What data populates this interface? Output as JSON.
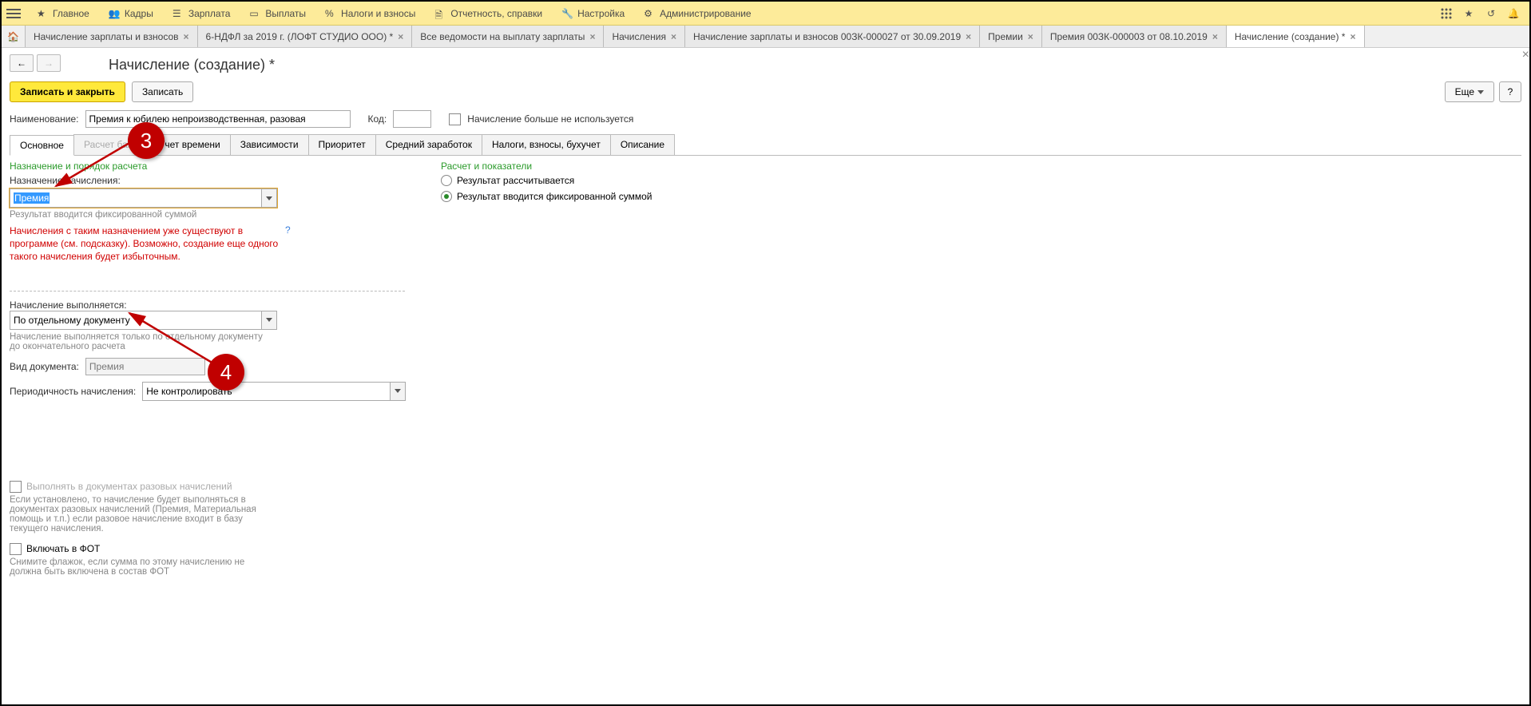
{
  "topnav": {
    "items": [
      {
        "icon": "star",
        "label": "Главное"
      },
      {
        "icon": "people",
        "label": "Кадры"
      },
      {
        "icon": "list",
        "label": "Зарплата"
      },
      {
        "icon": "wallet",
        "label": "Выплаты"
      },
      {
        "icon": "percent",
        "label": "Налоги и взносы"
      },
      {
        "icon": "doc",
        "label": "Отчетность, справки"
      },
      {
        "icon": "wrench",
        "label": "Настройка"
      },
      {
        "icon": "gear",
        "label": "Администрирование"
      }
    ]
  },
  "tabs": [
    {
      "label": "Начисление зарплаты и взносов",
      "active": false
    },
    {
      "label": "6-НДФЛ за 2019 г. (ЛОФТ СТУДИО ООО) *",
      "active": false
    },
    {
      "label": "Все ведомости на выплату зарплаты",
      "active": false
    },
    {
      "label": "Начисления",
      "active": false
    },
    {
      "label": "Начисление зарплаты и взносов 00ЗК-000027 от 30.09.2019",
      "active": false
    },
    {
      "label": "Премии",
      "active": false
    },
    {
      "label": "Премия 00ЗК-000003 от 08.10.2019",
      "active": false
    },
    {
      "label": "Начисление (создание) *",
      "active": true
    }
  ],
  "page_title": "Начисление (создание) *",
  "buttons": {
    "save_close": "Записать и закрыть",
    "save": "Записать",
    "more": "Еще"
  },
  "form": {
    "name_label": "Наименование:",
    "name_value": "Премия к юбилею непроизводственная, разовая",
    "code_label": "Код:",
    "code_value": "",
    "unused_label": "Начисление больше не используется"
  },
  "doctabs": [
    {
      "label": "Основное",
      "active": true
    },
    {
      "label": "Расчет базы",
      "disabled": true
    },
    {
      "label": "Учет времени",
      "disabled": false
    },
    {
      "label": "Зависимости"
    },
    {
      "label": "Приоритет"
    },
    {
      "label": "Средний заработок"
    },
    {
      "label": "Налоги, взносы, бухучет"
    },
    {
      "label": "Описание"
    }
  ],
  "left": {
    "section": "Назначение и порядок расчета",
    "assign_label": "Назначение начисления:",
    "assign_value": "Премия",
    "assign_hint": "Результат вводится фиксированной суммой",
    "warning": "Начисления с таким назначением уже существуют в программе (см. подсказку). Возможно, создание еще одного такого начисления будет избыточным.",
    "exec_label": "Начисление выполняется:",
    "exec_value": "По отдельному документу",
    "exec_hint": "Начисление выполняется только по отдельному документу до окончательного расчета",
    "doctype_label": "Вид документа:",
    "doctype_value": "Премия",
    "period_label": "Периодичность начисления:",
    "period_value": "Не контролировать",
    "onceoff_label": "Выполнять в документах разовых начислений",
    "onceoff_hint": "Если установлено, то начисление будет выполняться в документах разовых начислений (Премия, Материальная помощь и т.п.) если разовое начисление входит в базу текущего начисления.",
    "fot_label": "Включать в ФОТ",
    "fot_hint": "Снимите флажок, если сумма по этому начислению не должна быть включена в состав ФОТ"
  },
  "right": {
    "section": "Расчет и показатели",
    "radio1": "Результат рассчитывается",
    "radio2": "Результат вводится фиксированной суммой"
  },
  "annotations": {
    "a3": "3",
    "a4": "4"
  }
}
